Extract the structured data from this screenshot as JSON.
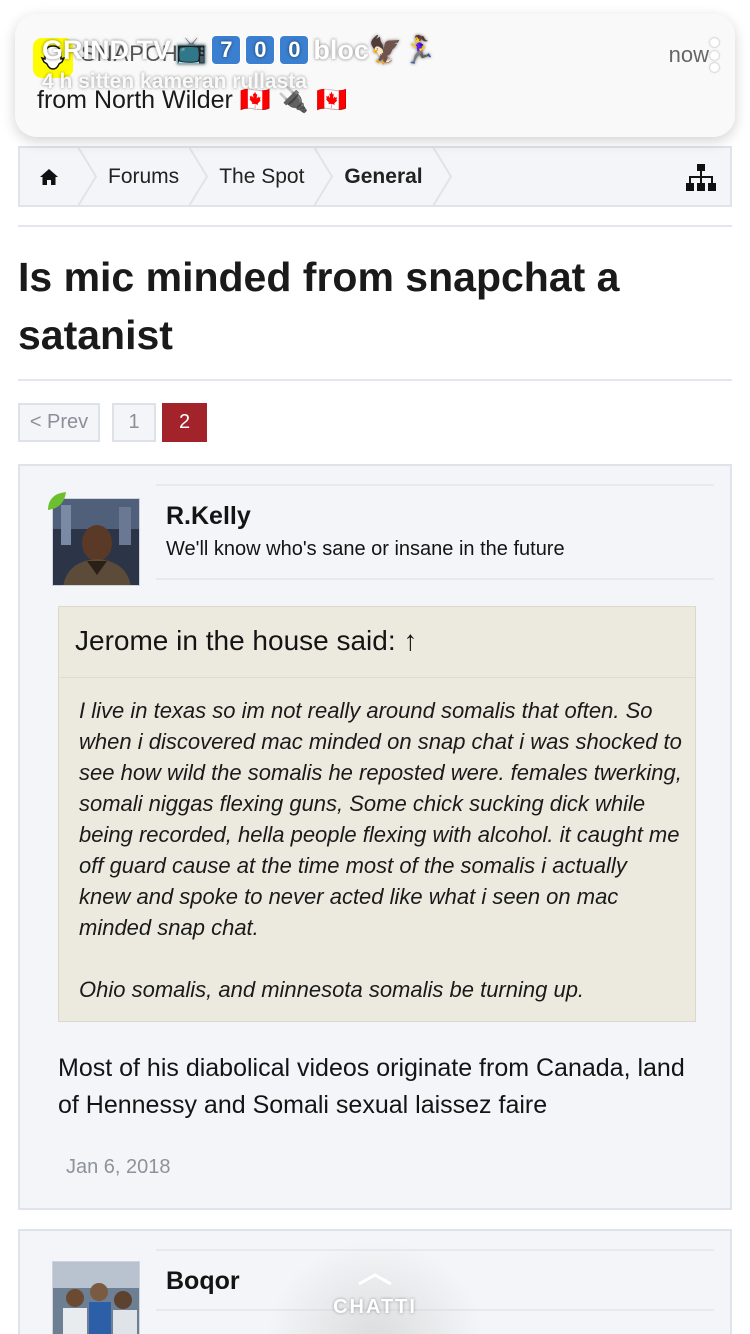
{
  "notification": {
    "app_name": "SNAPCHAT",
    "time": "now",
    "body": "from North Wilder 🇨🇦 🔌 🇨🇦",
    "overlay_text": "GRIND TV",
    "overlay_keys": [
      "7",
      "0",
      "0"
    ],
    "overlay_suffix": "bloc🦅🏃‍♀️",
    "overlay_sub": "4 h sitten kameran rullasta"
  },
  "breadcrumb": {
    "items": [
      "Forums",
      "The Spot",
      "General"
    ]
  },
  "thread": {
    "title": "Is mic minded from snapchat a satanist"
  },
  "pagination": {
    "prev_label": "< Prev",
    "pages": [
      "1",
      "2"
    ],
    "current": "2"
  },
  "posts": [
    {
      "username": "R.Kelly",
      "user_title": "We'll know who's sane or insane in the future",
      "quote": {
        "header": "Jerome in the house said: ↑",
        "paragraphs": [
          "I live in texas so im not really around somalis that often. So when i discovered mac minded on snap chat i was shocked to see how wild the somalis he reposted were. females twerking, somali niggas flexing guns, Some chick sucking dick while being recorded, hella people flexing with alcohol. it caught me off guard cause at the time most of the somalis i actually knew and spoke to never acted like what i seen on mac minded snap chat.",
          "Ohio somalis, and minnesota somalis be turning up."
        ]
      },
      "message": "Most of his diabolical videos originate from Canada, land of Hennessy and Somali sexual laissez faire",
      "date": "Jan 6, 2018"
    },
    {
      "username": "Boqor"
    }
  ],
  "chat_button": {
    "label": "CHATTI"
  },
  "colors": {
    "accent": "#a3232a",
    "quote_bg": "#eceadf",
    "post_bg": "#f4f5f8",
    "snap_yellow": "#fffc00"
  }
}
